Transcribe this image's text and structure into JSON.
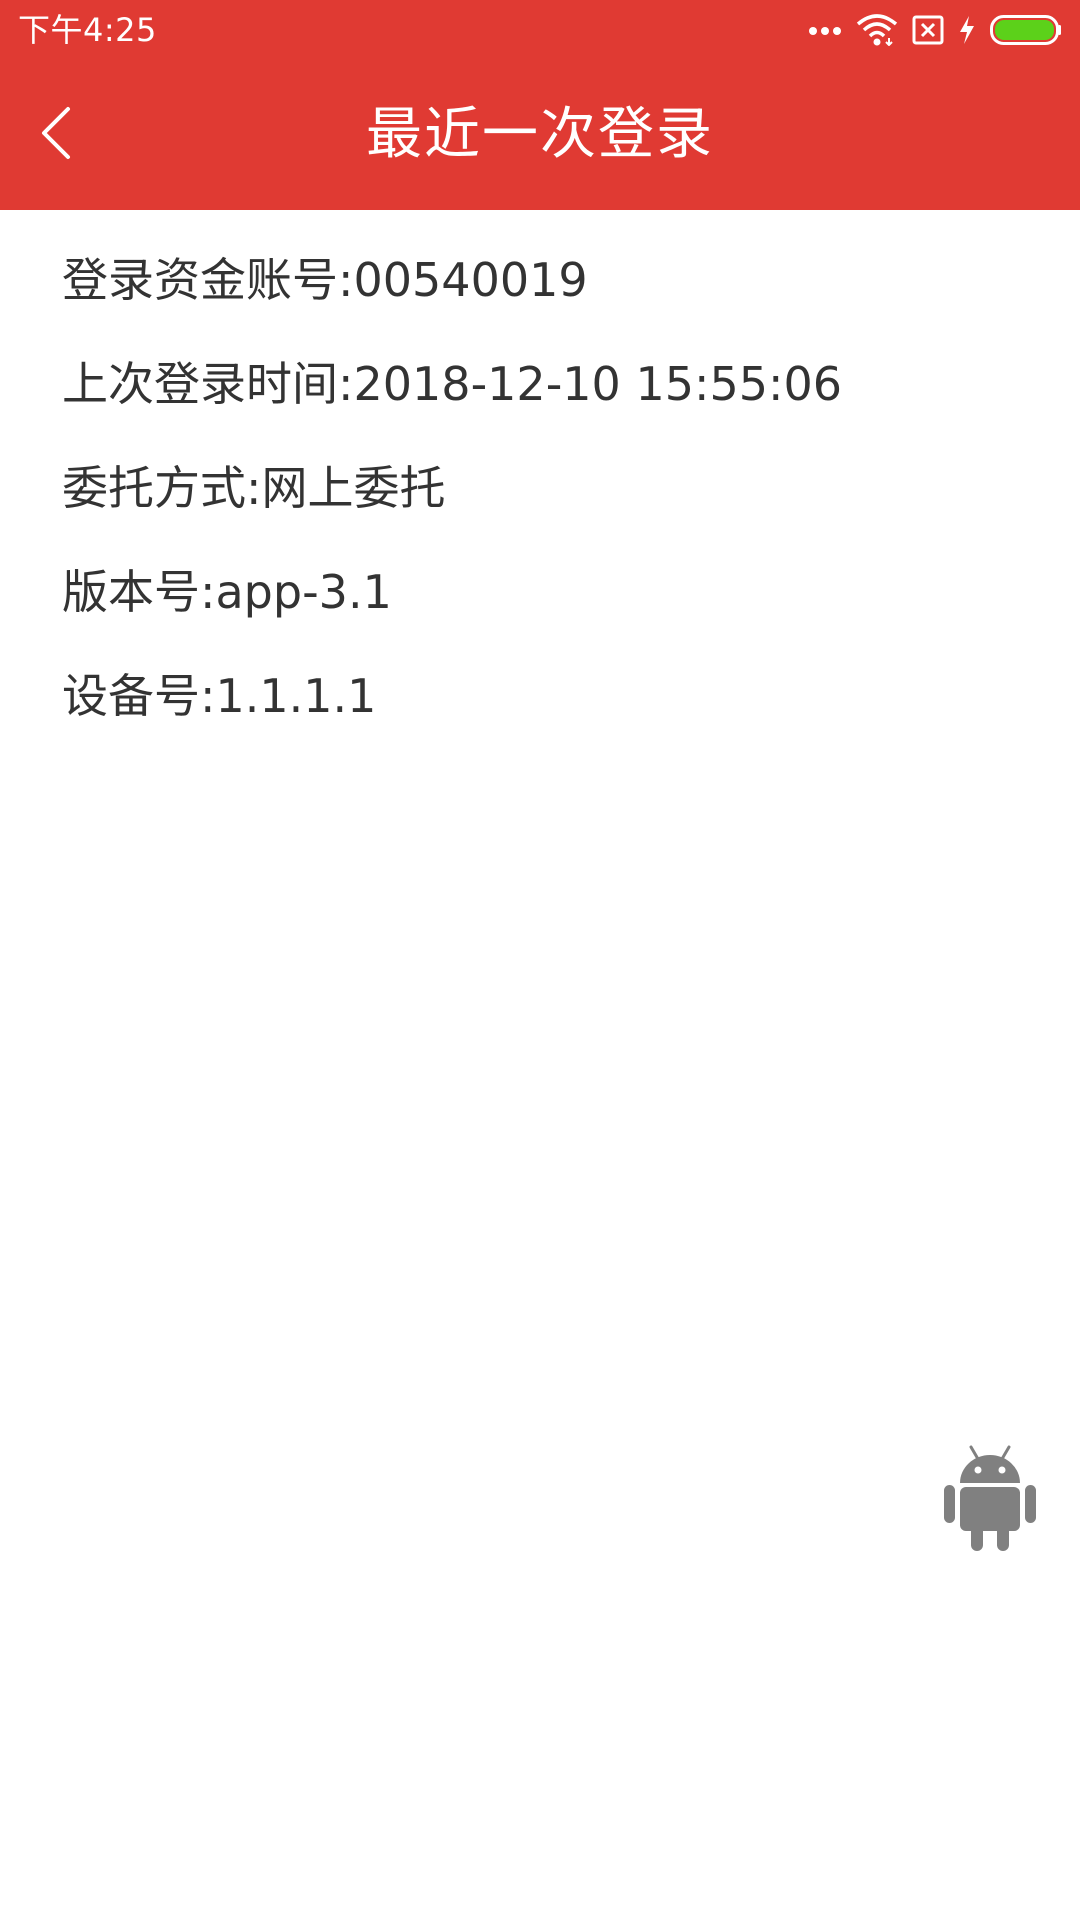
{
  "status_bar": {
    "time": "下午4:25",
    "icons": [
      "more-dots-icon",
      "wifi-icon",
      "sim-disabled-icon",
      "charging-bolt-icon",
      "battery-icon"
    ],
    "battery_color": "#5cd11a"
  },
  "header": {
    "title": "最近一次登录",
    "background_color": "#e03a33",
    "back_icon": "chevron-left-icon"
  },
  "details": [
    {
      "label": "登录资金账号",
      "value": "00540019",
      "text": "登录资金账号:00540019"
    },
    {
      "label": "上次登录时间",
      "value": "2018-12-10 15:55:06",
      "text": "上次登录时间:2018-12-10 15:55:06"
    },
    {
      "label": "委托方式",
      "value": "网上委托",
      "text": "委托方式:网上委托"
    },
    {
      "label": "版本号",
      "value": "app-3.1",
      "text": "版本号:app-3.1"
    },
    {
      "label": "设备号",
      "value": "1.1.1.1",
      "text": "设备号:1.1.1.1"
    }
  ],
  "floating_icon": "android-robot-icon"
}
